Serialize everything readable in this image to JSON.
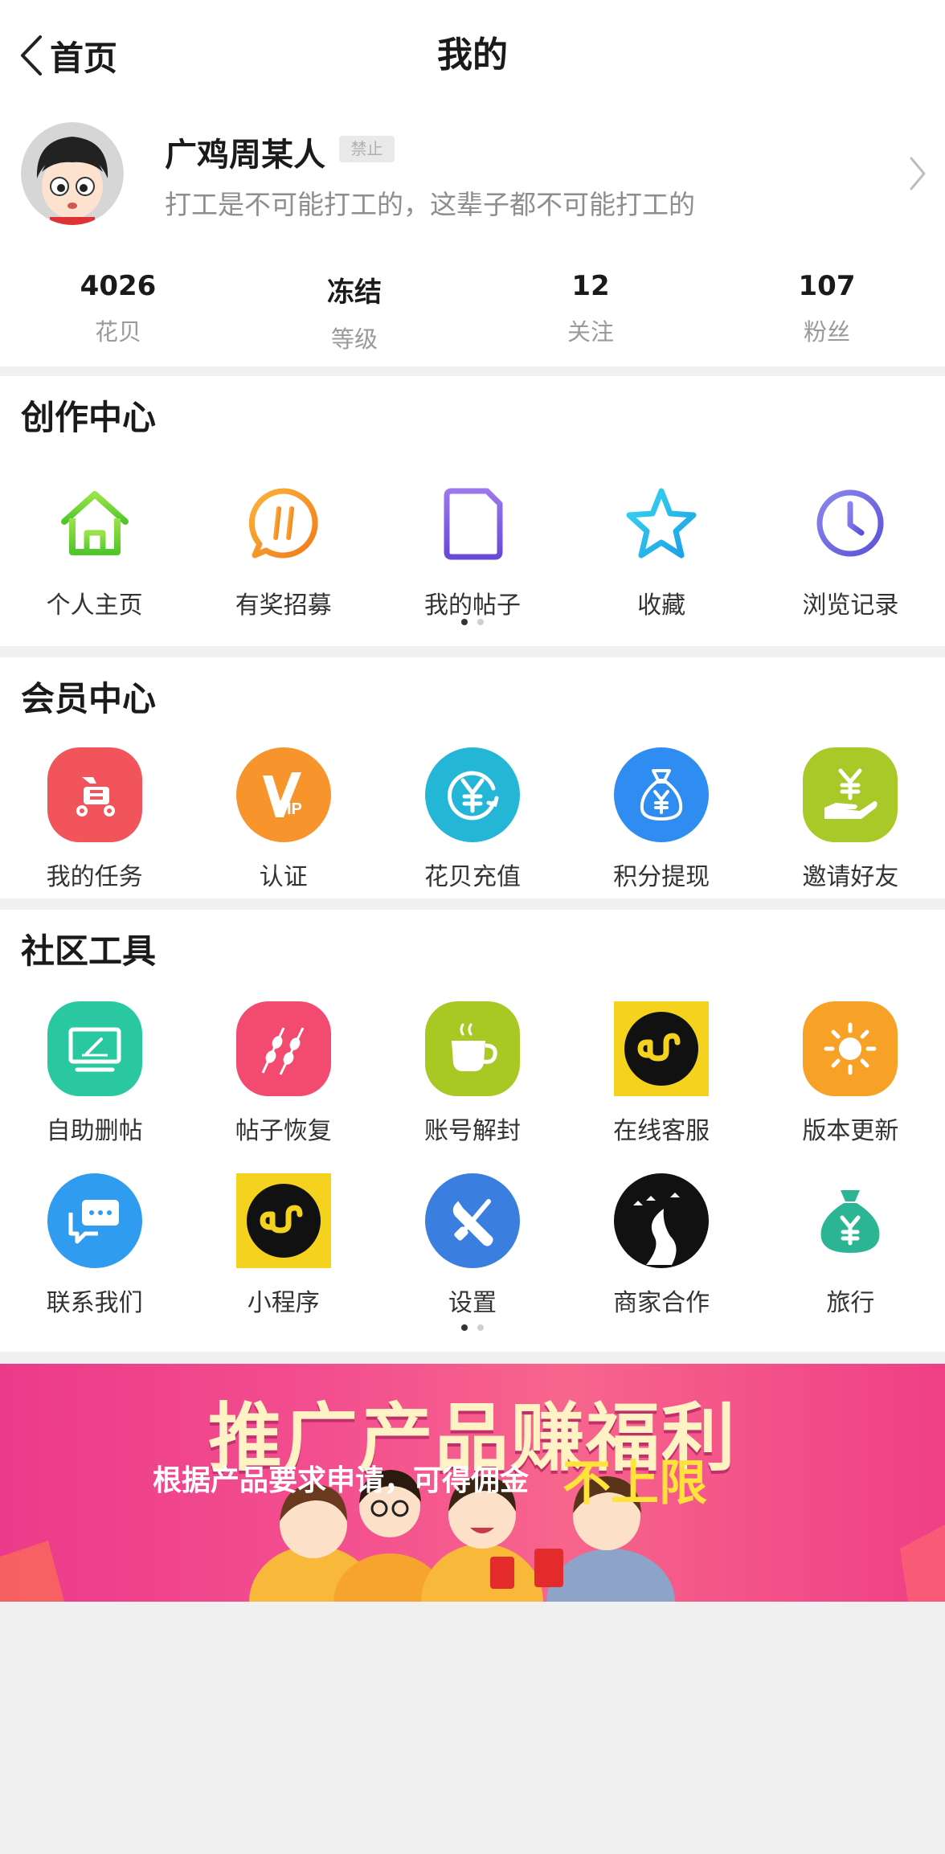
{
  "header": {
    "back_label": "首页",
    "title": "我的"
  },
  "profile": {
    "username": "广鸡周某人",
    "badge": "禁止",
    "bio": "打工是不可能打工的，这辈子都不可能打工的"
  },
  "stats": [
    {
      "value": "4026",
      "label": "花贝"
    },
    {
      "value": "冻结",
      "label": "等级"
    },
    {
      "value": "12",
      "label": "关注"
    },
    {
      "value": "107",
      "label": "粉丝"
    }
  ],
  "creation_center": {
    "title": "创作中心",
    "items": [
      {
        "label": "个人主页",
        "icon": "home-icon"
      },
      {
        "label": "有奖招募",
        "icon": "hashtag-icon"
      },
      {
        "label": "我的帖子",
        "icon": "post-icon"
      },
      {
        "label": "收藏",
        "icon": "star-icon"
      },
      {
        "label": "浏览记录",
        "icon": "clock-icon"
      }
    ]
  },
  "member_center": {
    "title": "会员中心",
    "items": [
      {
        "label": "我的任务",
        "icon": "task-scooter-icon",
        "color": "#f2545b"
      },
      {
        "label": "认证",
        "icon": "vip-icon",
        "color": "#f7952c"
      },
      {
        "label": "花贝充值",
        "icon": "yen-recharge-icon",
        "color": "#23b6d6"
      },
      {
        "label": "积分提现",
        "icon": "money-bag-icon",
        "color": "#2f8cf0"
      },
      {
        "label": "邀请好友",
        "icon": "yen-hand-icon",
        "color": "#a9c928"
      }
    ]
  },
  "community_tools": {
    "title": "社区工具",
    "items": [
      {
        "label": "自助删帖",
        "icon": "monitor-icon",
        "color": "#2ac8a0"
      },
      {
        "label": "帖子恢复",
        "icon": "skewer-icon",
        "color": "#f24b6f"
      },
      {
        "label": "账号解封",
        "icon": "coffee-cup-icon",
        "color": "#a8c823"
      },
      {
        "label": "在线客服",
        "icon": "mini-program-icon",
        "color": "#f5d21e"
      },
      {
        "label": "版本更新",
        "icon": "sun-icon",
        "color": "#f7a127"
      },
      {
        "label": "联系我们",
        "icon": "chat-bubbles-icon",
        "color": "#2f9cf0"
      },
      {
        "label": "小程序",
        "icon": "mini-program-icon",
        "color": "#f5d21e"
      },
      {
        "label": "设置",
        "icon": "tools-icon",
        "color": "#3a7fe0"
      },
      {
        "label": "商家合作",
        "icon": "night-road-icon",
        "color": "#111111"
      },
      {
        "label": "旅行",
        "icon": "money-bag-icon",
        "color": "#2bb594"
      }
    ]
  },
  "banner": {
    "title": "推广产品赚福利",
    "subtitle": "根据产品要求申请，可得佣金",
    "highlight": "不上限"
  }
}
